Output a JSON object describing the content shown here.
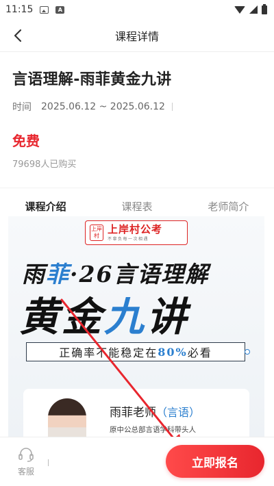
{
  "status_bar": {
    "time": "11:15"
  },
  "nav": {
    "title": "课程详情"
  },
  "course": {
    "title": "言语理解-雨菲黄金九讲",
    "time_label": "时间",
    "time_value": "2025.06.12 ~ 2025.06.12",
    "price": "免费",
    "buyers": "79698人已购买"
  },
  "tabs": [
    {
      "label": "课程介绍",
      "active": true
    },
    {
      "label": "课程表",
      "active": false
    },
    {
      "label": "老师简介",
      "active": false
    }
  ],
  "poster": {
    "logo_seal": "上岸村",
    "logo_name": "上岸村公考",
    "logo_slogan": "不辜负每一次相遇",
    "line1_a": "雨",
    "line1_b": "菲",
    "line1_c": "·26言语理解",
    "line2_a": "黄金",
    "line2_b": "九",
    "line2_c": "讲",
    "banner_a": "正确率不能稳定在",
    "banner_pct": "80%",
    "banner_b": "必看",
    "teacher_name": "雨菲老师",
    "teacher_subject": "（言语）",
    "teacher_desc": "原中公总部言语学科带头人"
  },
  "bottom_bar": {
    "service_label": "客服",
    "signup_label": "立即报名"
  },
  "colors": {
    "accent": "#e8262e",
    "poster_blue": "#2b7fcf"
  }
}
